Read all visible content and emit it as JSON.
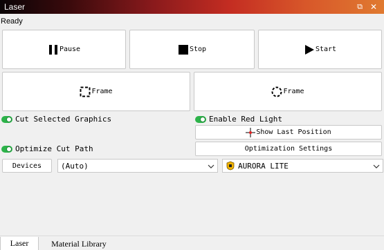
{
  "window": {
    "title": "Laser",
    "restore_glyph": "⧉",
    "close_glyph": "✕"
  },
  "status": "Ready",
  "controls": {
    "pause": "Pause",
    "stop": "Stop",
    "start": "Start",
    "frame_rect": "Frame",
    "frame_circle": "Frame"
  },
  "options": {
    "cut_selected": "Cut Selected Graphics",
    "enable_red_light": "Enable Red Light",
    "show_last_position": "Show Last Position",
    "optimize_cut_path": "Optimize Cut Path",
    "optimization_settings": "Optimization Settings",
    "toggle_color": "#2db34a"
  },
  "devices": {
    "button": "Devices",
    "port": "(Auto)",
    "device": "AURORA LITE"
  },
  "tabs": [
    {
      "label": "Laser",
      "active": true
    },
    {
      "label": "Material Library",
      "active": false
    }
  ]
}
